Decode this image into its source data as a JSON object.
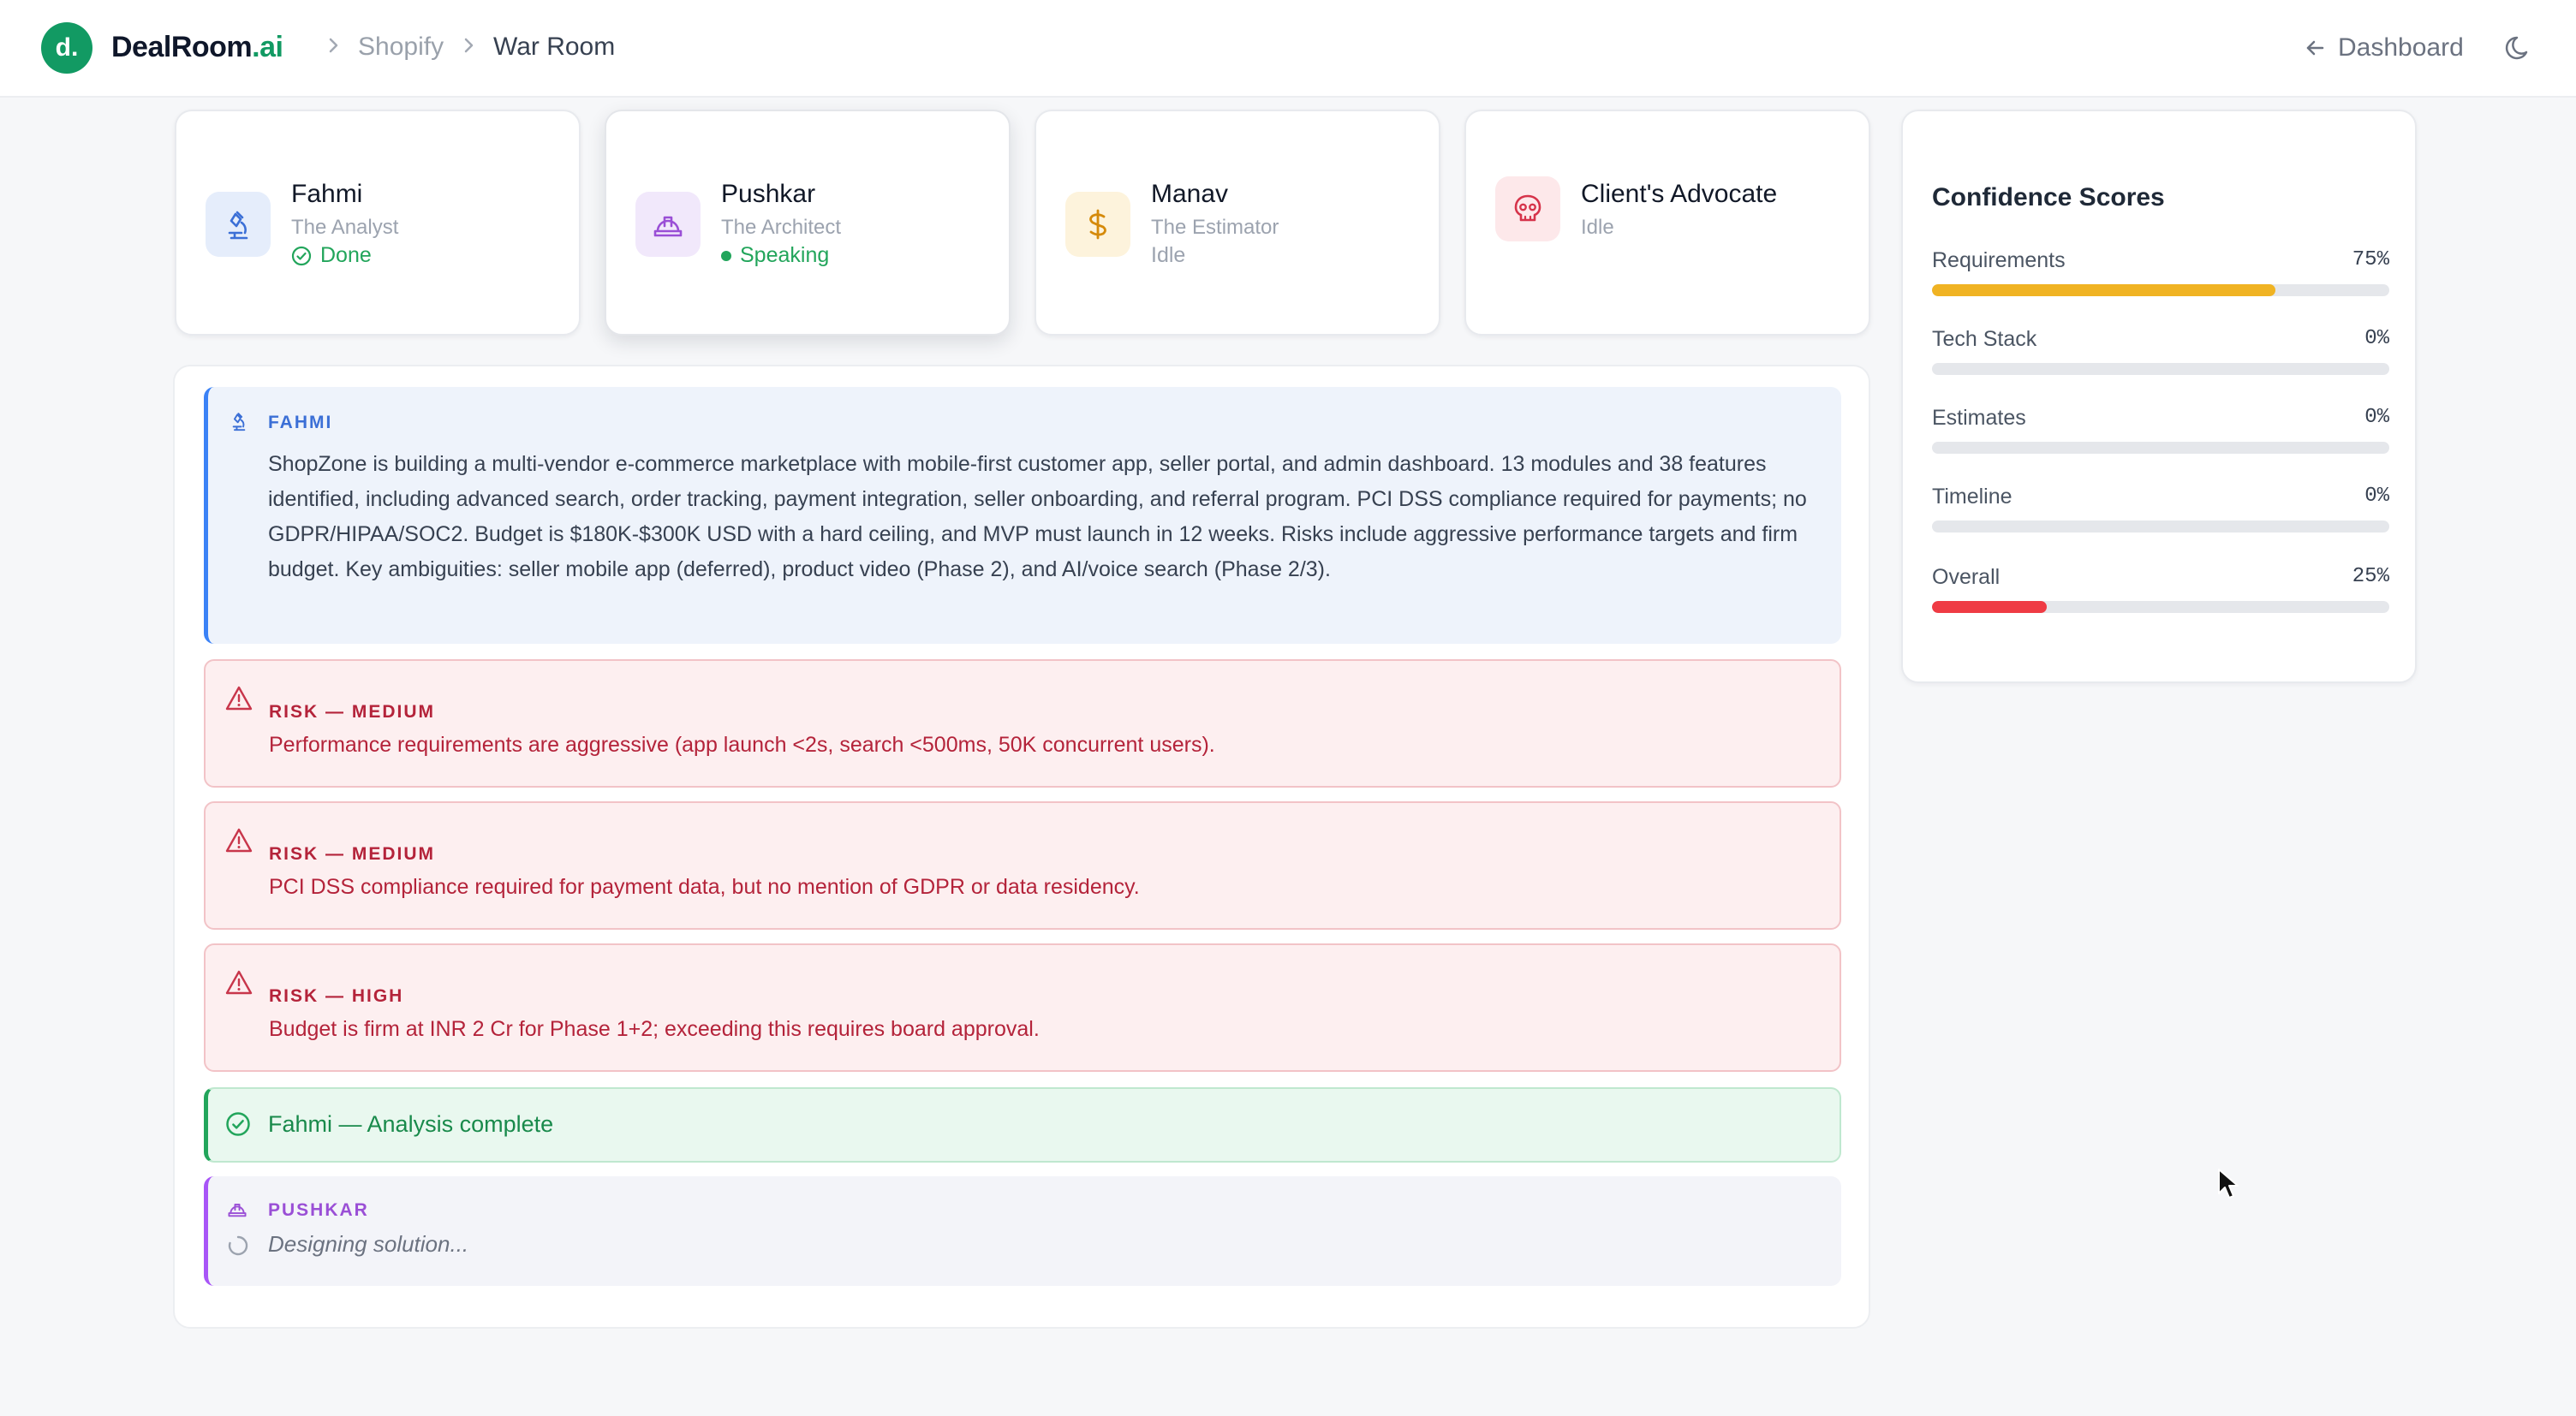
{
  "brand": {
    "logo_letter": "d.",
    "name": "DealRoom",
    "suffix": ".ai",
    "accent": "#129a63"
  },
  "breadcrumb": [
    {
      "label": "Shopify"
    },
    {
      "label": "War Room"
    }
  ],
  "header": {
    "dashboard_label": "Dashboard"
  },
  "agents": [
    {
      "name": "Fahmi",
      "role": "The Analyst",
      "status": "Done",
      "status_color": "#22a55b",
      "icon": "microscope-icon",
      "icon_bg": "#e5edfb"
    },
    {
      "name": "Pushkar",
      "role": "The Architect",
      "status": "Speaking",
      "status_color": "#22a55b",
      "icon": "hard-hat-icon",
      "icon_bg": "#f1e8fb"
    },
    {
      "name": "Manav",
      "role": "The Estimator",
      "status": "Idle",
      "status_color": "#9ca3af",
      "icon": "dollar-icon",
      "icon_bg": "#fdf3dc"
    },
    {
      "name": "Client's Advocate",
      "role": "",
      "status": "Idle",
      "status_color": "#9ca3af",
      "icon": "skull-icon",
      "icon_bg": "#fde8ea"
    }
  ],
  "confidence": {
    "title": "Confidence Scores",
    "items": [
      {
        "label": "Requirements",
        "value": "75%",
        "fraction": 0.75,
        "color": "#f0b323"
      },
      {
        "label": "Tech Stack",
        "value": "0%",
        "fraction": 0,
        "color": "#f0b323"
      },
      {
        "label": "Estimates",
        "value": "0%",
        "fraction": 0,
        "color": "#f0b323"
      },
      {
        "label": "Timeline",
        "value": "0%",
        "fraction": 0,
        "color": "#f0b323"
      },
      {
        "label": "Overall",
        "value": "25%",
        "fraction": 0.25,
        "color": "#ef3b44"
      }
    ]
  },
  "feed": {
    "analysis": {
      "author": "FAHMI",
      "text": "ShopZone is building a multi-vendor e-commerce marketplace with mobile-first customer app, seller portal, and admin dashboard. 13 modules and 38 features identified, including advanced search, order tracking, payment integration, seller onboarding, and referral program. PCI DSS compliance required for payments; no GDPR/HIPAA/SOC2. Budget is $180K-$300K USD with a hard ceiling, and MVP must launch in 12 weeks. Risks include aggressive performance targets and firm budget. Key ambiguities: seller mobile app (deferred), product video (Phase 2), and AI/voice search (Phase 2/3)."
    },
    "risks": [
      {
        "label": "RISK — MEDIUM",
        "text": "Performance requirements are aggressive (app launch <2s, search <500ms, 50K concurrent users)."
      },
      {
        "label": "RISK — MEDIUM",
        "text": "PCI DSS compliance required for payment data, but no mention of GDPR or data residency."
      },
      {
        "label": "RISK — HIGH",
        "text": "Budget is firm at INR 2 Cr for Phase 1+2; exceeding this requires board approval."
      }
    ],
    "done_text": "Fahmi — Analysis complete",
    "pending": {
      "author": "PUSHKAR",
      "text": "Designing solution..."
    }
  }
}
